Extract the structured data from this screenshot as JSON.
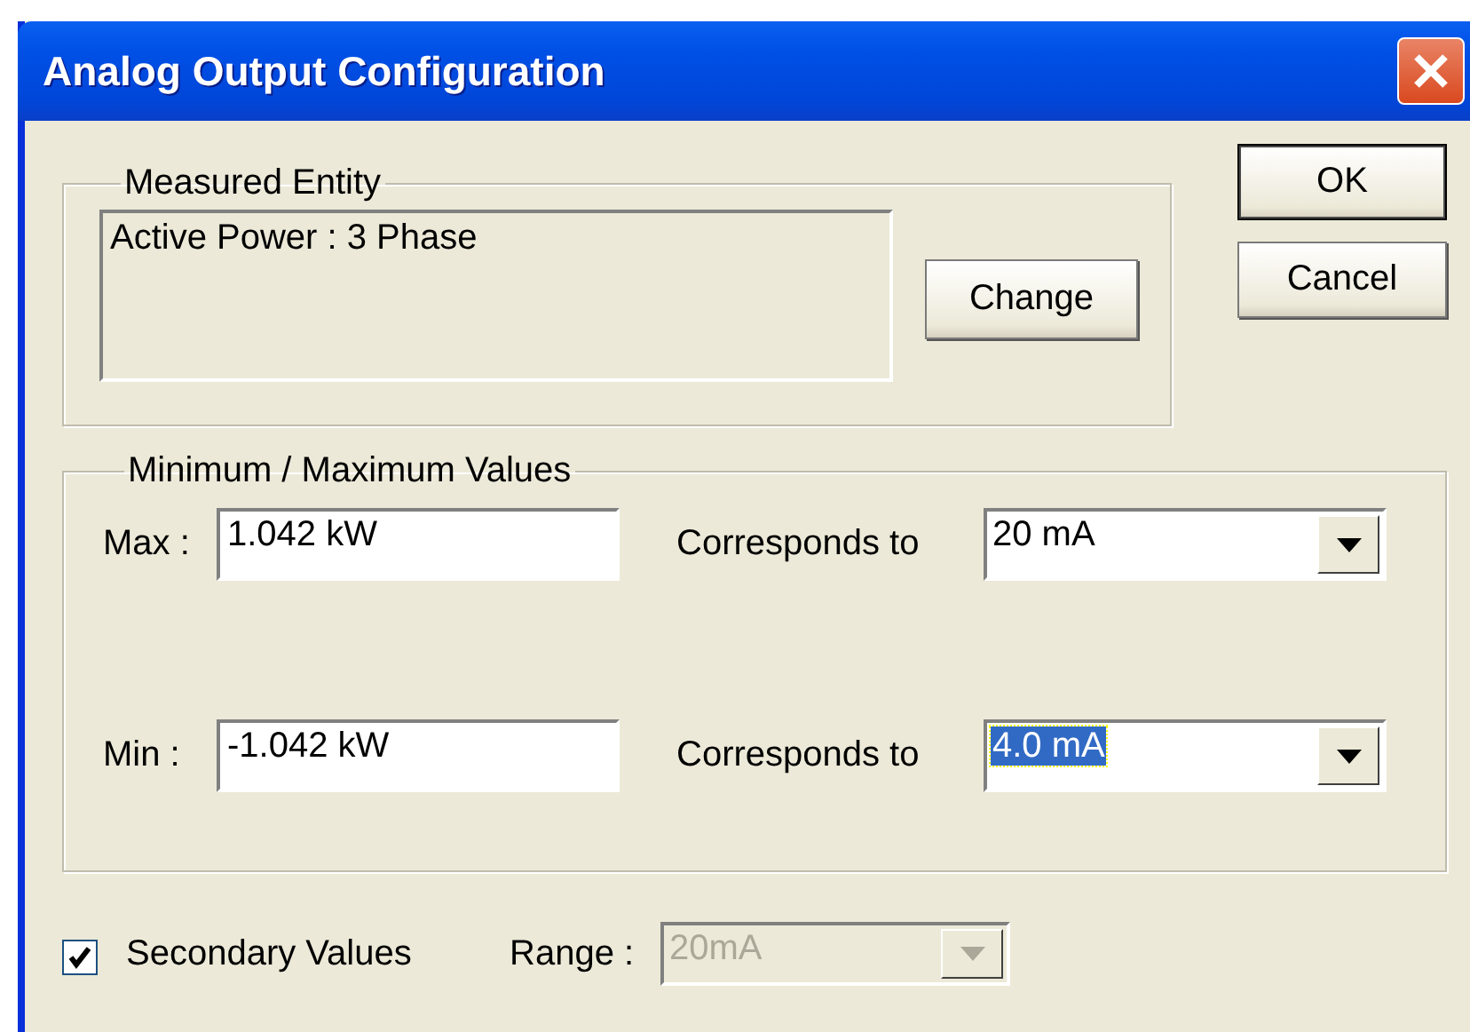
{
  "window": {
    "title": "Analog Output Configuration"
  },
  "measured_entity": {
    "label": "Measured Entity",
    "value": "Active Power : 3 Phase",
    "change_button": "Change"
  },
  "buttons": [
    {
      "label": "OK",
      "default": true
    },
    {
      "label": "Cancel",
      "default": false
    }
  ],
  "min_max": {
    "label": "Minimum / Maximum Values",
    "rows": [
      {
        "label": "Max :",
        "value": "1.042 kW",
        "corresponds_label": "Corresponds to",
        "option": "20 mA",
        "option_selected": false
      },
      {
        "label": "Min :",
        "value": "-1.042 kW",
        "corresponds_label": "Corresponds to",
        "option": "4.0 mA",
        "option_selected": true
      }
    ]
  },
  "secondary_values": {
    "label": "Secondary Values",
    "checked": true
  },
  "range": {
    "label": "Range :",
    "value": "20mA",
    "disabled": true
  }
}
